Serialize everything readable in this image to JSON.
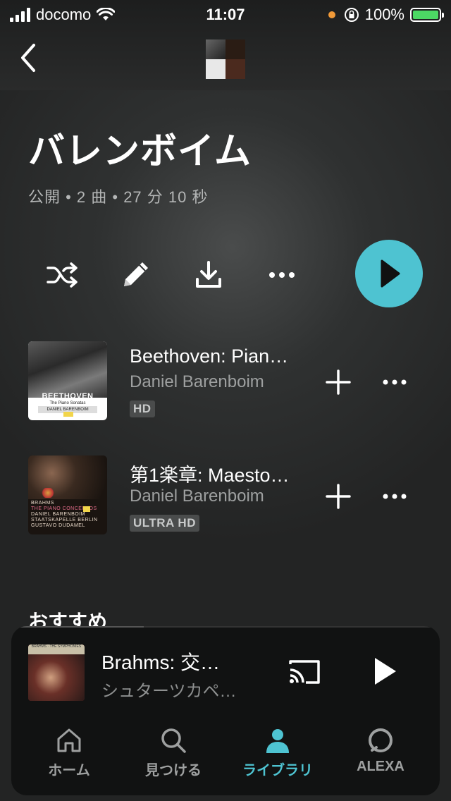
{
  "status_bar": {
    "carrier": "docomo",
    "time": "11:07",
    "battery": "100%"
  },
  "playlist": {
    "title": "バレンボイム",
    "meta": "公開 • 2 曲 • 27 分 10 秒"
  },
  "tracks": [
    {
      "title": "Beethoven: Pian…",
      "artist": "Daniel Barenboim",
      "badge": "HD",
      "art_text": {
        "name": "BEETHOVEN",
        "sub": "The Piano Sonatas",
        "credit": "DANIEL BARENBOIM"
      }
    },
    {
      "title": "第1楽章: Maesto…",
      "artist": "Daniel Barenboim",
      "badge": "ULTRA HD",
      "art_text": {
        "line1": "BRAHMS",
        "line2": "THE PIANO CONCERTOS",
        "line3": "DANIEL BARENBOIM",
        "line4": "STAATSKAPELLE BERLIN",
        "line5": "GUSTAVO DUDAMEL"
      }
    }
  ],
  "section": {
    "title": "おすすめ"
  },
  "now_playing": {
    "title": "Brahms: 交…",
    "subtitle": "シュターツカペ…",
    "art_text": "BRAHMS · THE SYMPHONIES",
    "progress": 0.31
  },
  "tabs": [
    {
      "label": "ホーム",
      "icon": "home-icon"
    },
    {
      "label": "見つける",
      "icon": "search-icon"
    },
    {
      "label": "ライブラリ",
      "icon": "library-person-icon",
      "active": true
    },
    {
      "label": "ALEXA",
      "icon": "alexa-icon"
    }
  ],
  "colors": {
    "accent": "#4ec3d1",
    "background": "#2b2d2d",
    "secondary_text": "#9ea0a0"
  }
}
